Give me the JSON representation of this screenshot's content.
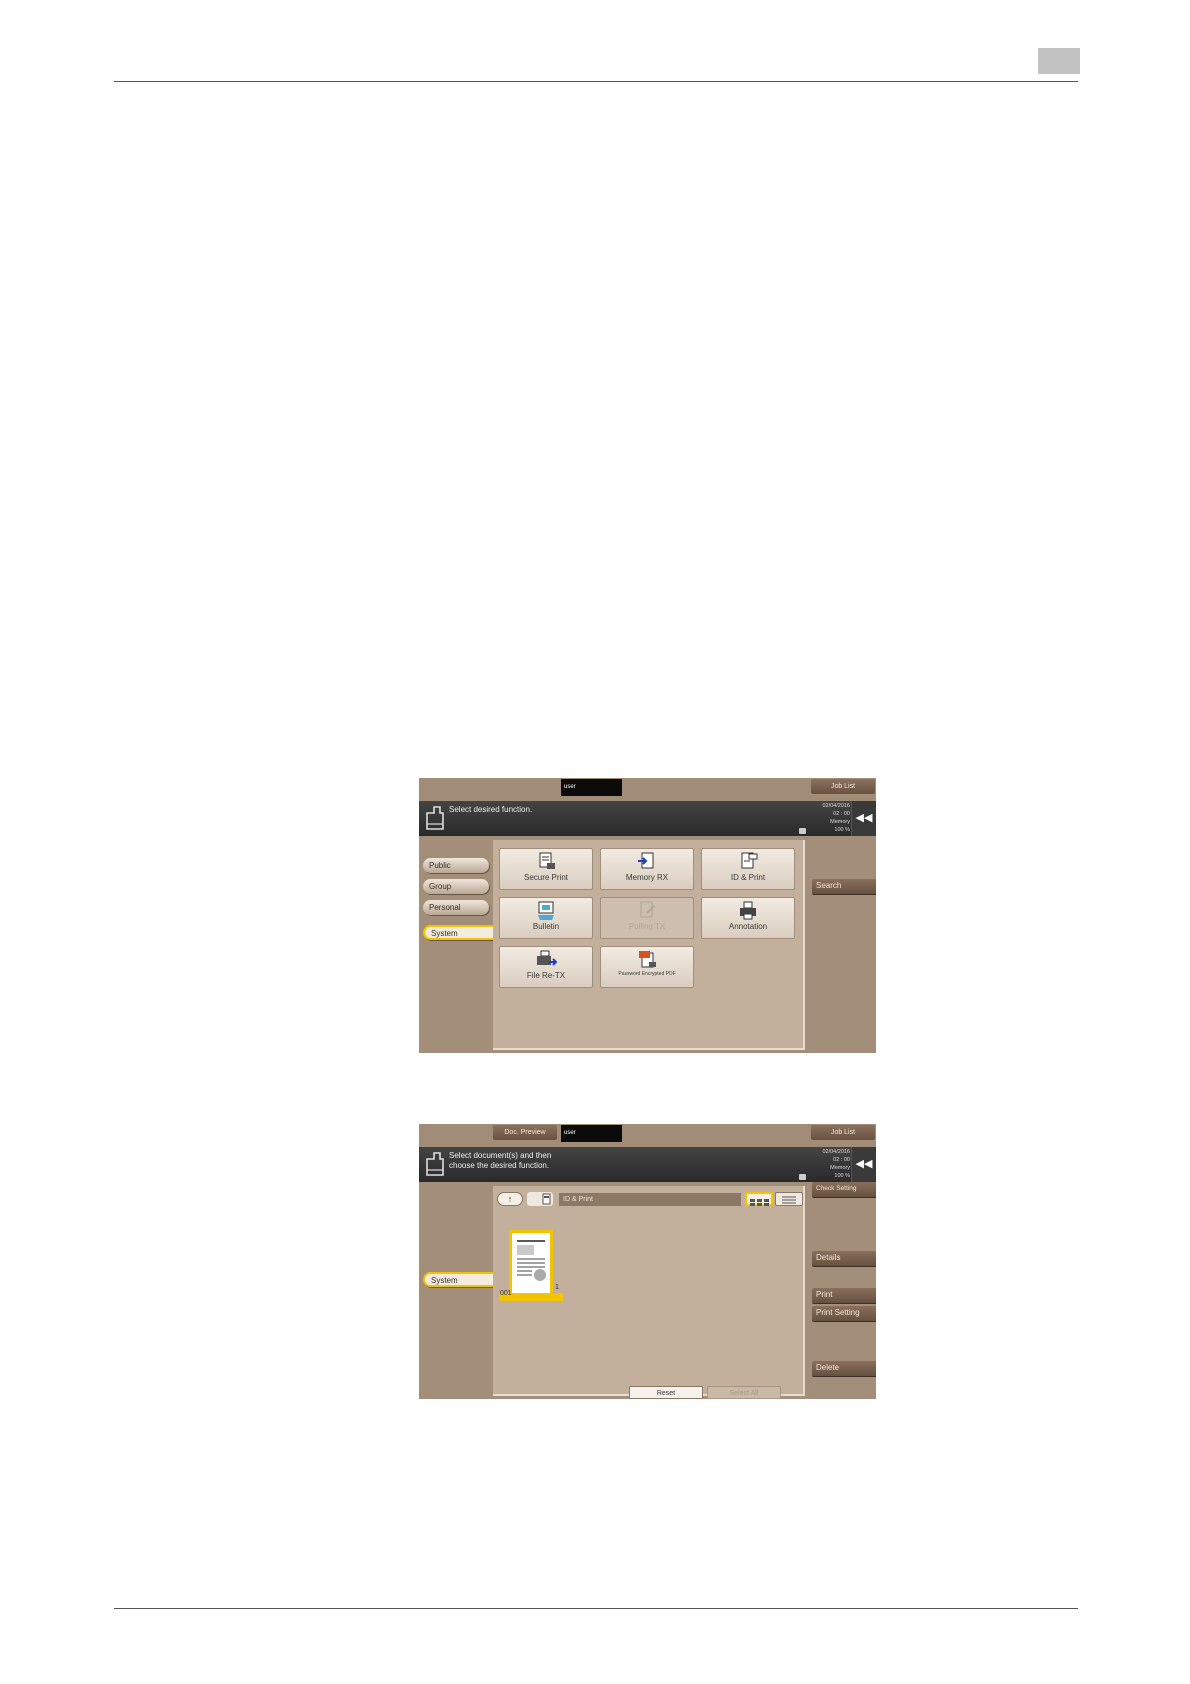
{
  "panel1": {
    "user_label": "user",
    "job_list": "Job List",
    "message": "Select desired function.",
    "date": "02/04/2016",
    "time": "02 : 00",
    "memory_label": "Memory",
    "memory_value": "100 %",
    "tabs": [
      "Public",
      "Group",
      "Personal",
      "System"
    ],
    "search": "Search",
    "functions": [
      {
        "label": "Secure Print",
        "icon": "secure-print-icon"
      },
      {
        "label": "Memory RX",
        "icon": "memory-rx-icon"
      },
      {
        "label": "ID & Print",
        "icon": "id-print-icon"
      },
      {
        "label": "Bulletin",
        "icon": "bulletin-icon"
      },
      {
        "label": "Polling TX",
        "icon": "polling-tx-icon",
        "disabled": true
      },
      {
        "label": "Annotation",
        "icon": "annotation-icon"
      },
      {
        "label": "File Re-TX",
        "icon": "file-retx-icon"
      },
      {
        "label": "Password Encrypted PDF",
        "icon": "pdf-icon"
      }
    ]
  },
  "panel2": {
    "doc_preview": "Doc. Preview",
    "user_label": "user",
    "job_list": "Job List",
    "message_line1": "Select document(s) and then",
    "message_line2": "choose the desired function.",
    "date": "02/04/2016",
    "time": "02 : 00",
    "memory_label": "Memory",
    "memory_value": "100 %",
    "check_setting": "Check Setting",
    "path": "ID & Print",
    "tab": "System",
    "doc_number": "001",
    "doc_count": "1",
    "right_buttons": [
      "Details",
      "Print",
      "Print Setting",
      "Delete"
    ],
    "reset": "Reset",
    "select_all": "Select All"
  }
}
